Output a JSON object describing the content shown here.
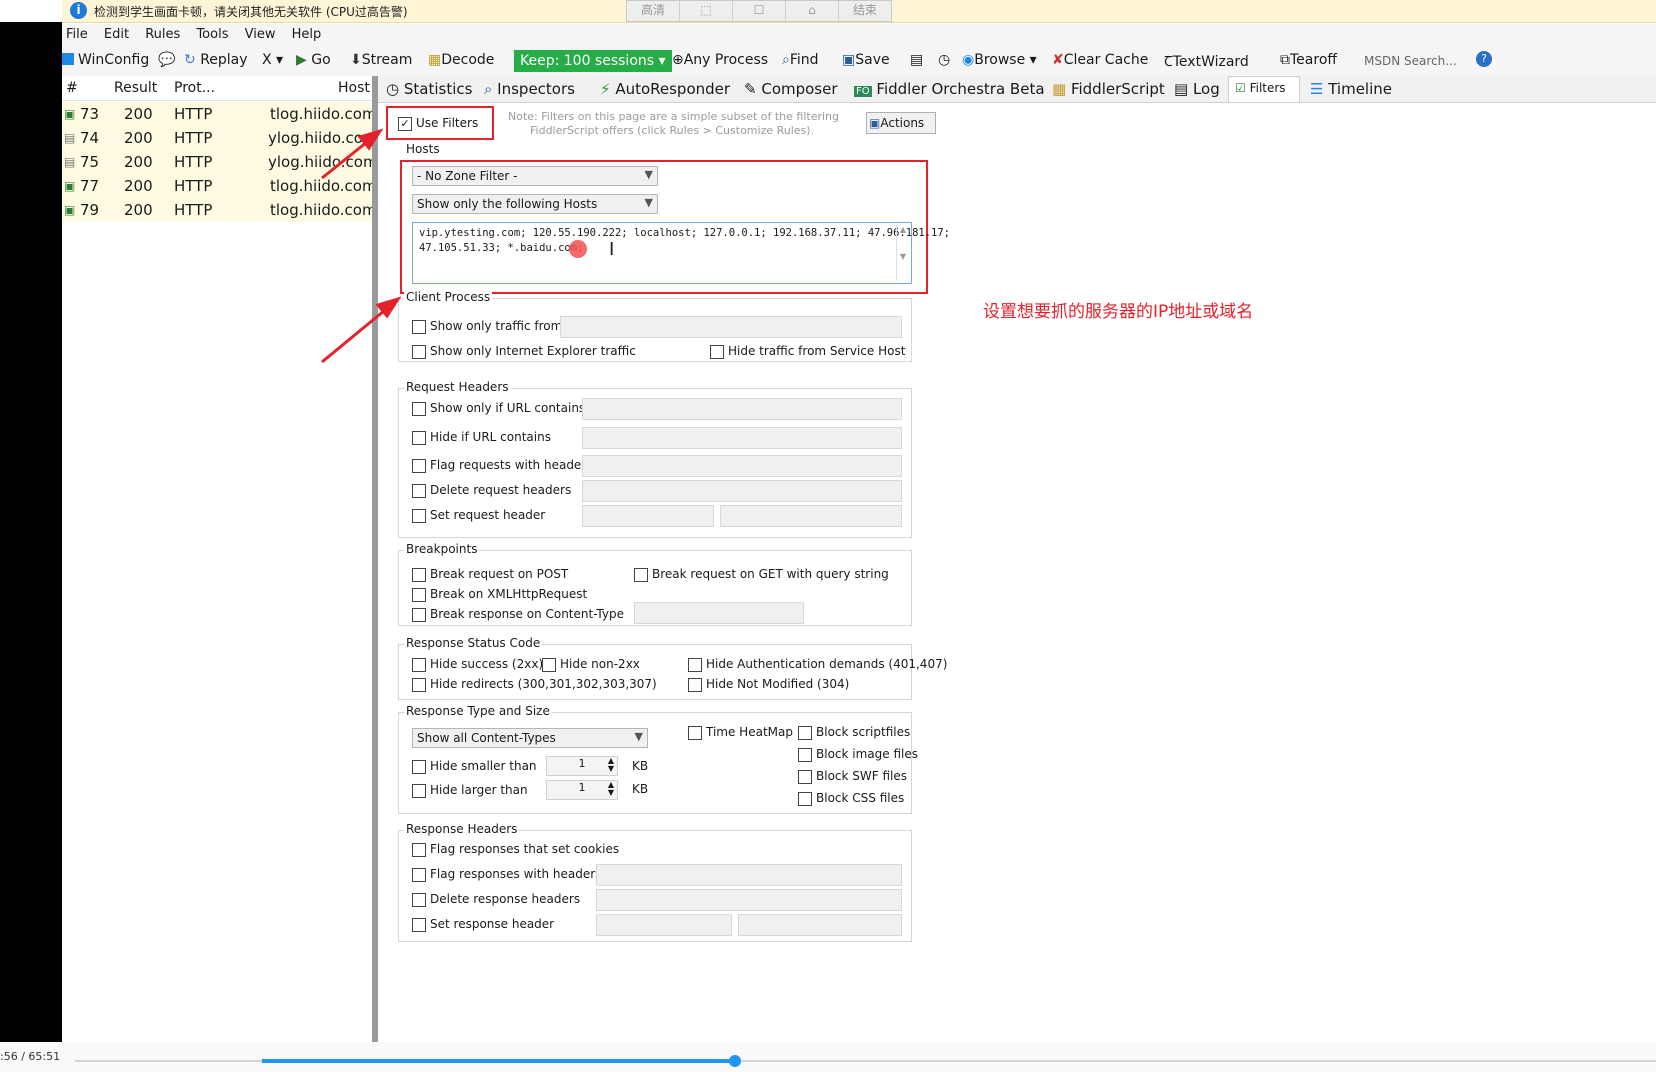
{
  "notification": {
    "text": "检测到学生画面卡顿，请关闭其他无关软件 (CPU过高告警)",
    "controls": [
      "高清",
      "",
      "",
      "",
      "结束"
    ]
  },
  "menu": [
    "File",
    "Edit",
    "Rules",
    "Tools",
    "View",
    "Help"
  ],
  "toolbar": {
    "winconfig": "WinConfig",
    "replay": "Replay",
    "remove": "X",
    "go": "Go",
    "stream": "Stream",
    "decode": "Decode",
    "keep": "Keep: 100 sessions",
    "any_process": "Any Process",
    "find": "Find",
    "save": "Save",
    "browse": "Browse",
    "clear_cache": "Clear Cache",
    "textwizard": "TextWizard",
    "tearoff": "Tearoff",
    "msdn_search": "MSDN Search..."
  },
  "sessions": {
    "columns": [
      "#",
      "Result",
      "Prot...",
      "Host"
    ],
    "rows": [
      {
        "id": "73",
        "result": "200",
        "protocol": "HTTP",
        "host": "tlog.hiido.com"
      },
      {
        "id": "74",
        "result": "200",
        "protocol": "HTTP",
        "host": "ylog.hiido.com"
      },
      {
        "id": "75",
        "result": "200",
        "protocol": "HTTP",
        "host": "ylog.hiido.com"
      },
      {
        "id": "77",
        "result": "200",
        "protocol": "HTTP",
        "host": "tlog.hiido.com"
      },
      {
        "id": "79",
        "result": "200",
        "protocol": "HTTP",
        "host": "tlog.hiido.com"
      }
    ]
  },
  "tabs": [
    "Statistics",
    "Inspectors",
    "AutoResponder",
    "Composer",
    "Fiddler Orchestra Beta",
    "FiddlerScript",
    "Log",
    "Filters",
    "Timeline"
  ],
  "filters": {
    "use_filters": "Use Filters",
    "note_line1": "Note: Filters on this page are a simple subset of the filtering",
    "note_line2": "FiddlerScript offers (click Rules > Customize Rules).",
    "actions": "Actions",
    "hosts": {
      "label": "Hosts",
      "zone": "- No Zone Filter -",
      "mode": "Show only the following Hosts",
      "list_line1": "vip.ytesting.com; 120.55.190.222; localhost; 127.0.0.1; 192.168.37.11; 47.96.181.17;",
      "list_line2": "47.105.51.33; *.baidu.com;"
    },
    "client_process": {
      "label": "Client Process",
      "show_only_from": "Show only traffic from",
      "show_only_ie": "Show only Internet Explorer traffic",
      "hide_service_host": "Hide traffic from Service Host"
    },
    "request_headers": {
      "label": "Request Headers",
      "url_contains": "Show only if URL contains",
      "hide_url": "Hide if URL contains",
      "flag_headers": "Flag requests with headers",
      "delete_headers": "Delete request headers",
      "set_header": "Set request header"
    },
    "breakpoints": {
      "label": "Breakpoints",
      "post": "Break request on POST",
      "get_query": "Break request on GET with query string",
      "xhr": "Break on XMLHttpRequest",
      "content_type": "Break response on Content-Type"
    },
    "status_code": {
      "label": "Response Status Code",
      "hide_2xx": "Hide success (2xx)",
      "hide_non2xx": "Hide non-2xx",
      "hide_auth": "Hide Authentication demands (401,407)",
      "hide_redirects": "Hide redirects (300,301,302,303,307)",
      "hide_304": "Hide Not Modified (304)"
    },
    "type_size": {
      "label": "Response Type and Size",
      "content_types": "Show all Content-Types",
      "time_heatmap": "Time HeatMap",
      "block_script": "Block scriptfiles",
      "block_image": "Block image files",
      "block_swf": "Block SWF files",
      "block_css": "Block CSS files",
      "hide_smaller": "Hide smaller than",
      "hide_larger": "Hide larger than",
      "smaller_value": "1",
      "larger_value": "1",
      "unit": "KB"
    },
    "response_headers": {
      "label": "Response Headers",
      "flag_cookies": "Flag responses that set cookies",
      "flag_headers": "Flag responses with headers",
      "delete_headers": "Delete response headers",
      "set_header": "Set response header"
    }
  },
  "annotation": "设置想要抓的服务器的IP地址或域名",
  "player": {
    "time": ":56 / 65:51",
    "progress": 0.3
  },
  "colors": {
    "highlight_red": "#e5212b",
    "keep_green": "#27ad48",
    "progress_blue": "#2196f3"
  }
}
